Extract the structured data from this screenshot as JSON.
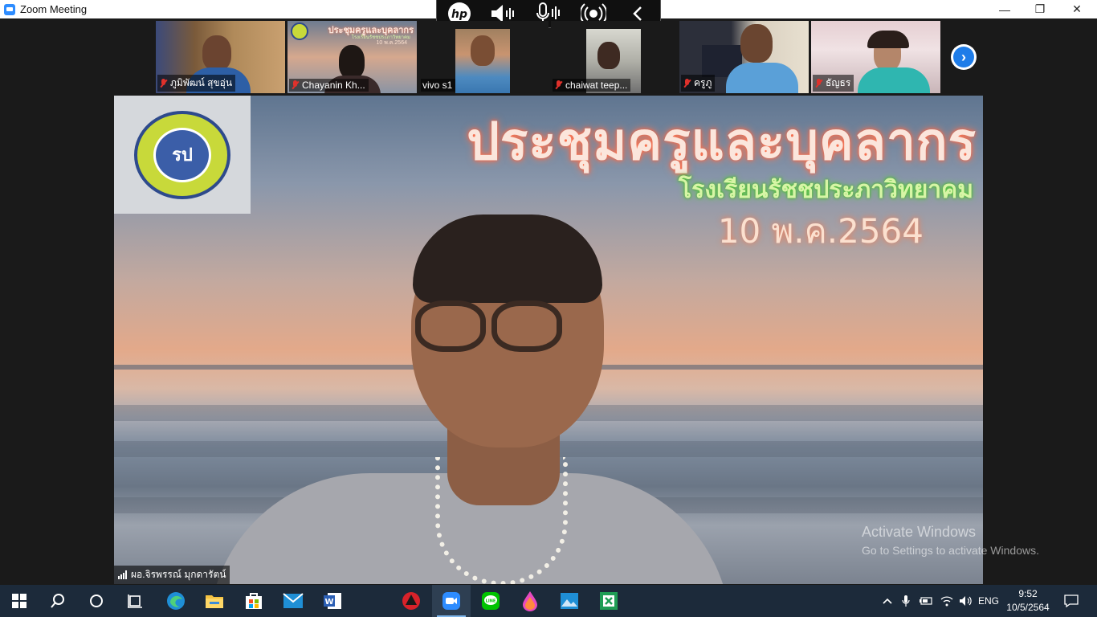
{
  "window": {
    "title": "Zoom Meeting",
    "controls": {
      "minimize": "—",
      "maximize": "❐",
      "close": "✕"
    }
  },
  "hp_toolbar": {
    "logo": "hp",
    "icons": [
      "speaker-icon",
      "microphone-icon",
      "broadcast-icon",
      "chevron-left-icon"
    ]
  },
  "participants": [
    {
      "name": "ภูมิพัฒน์ สุขอุ่น",
      "muted": true
    },
    {
      "name": "Chayanin Kh...",
      "muted": true
    },
    {
      "name": "vivo s1",
      "muted": false
    },
    {
      "name": "chaiwat teep...",
      "muted": true
    },
    {
      "name": "ครูภู",
      "muted": true
    },
    {
      "name": "ธัญธร",
      "muted": true
    }
  ],
  "thumb2_slide": {
    "title": "ประชุมครูและบุคลากร",
    "subtitle": "โรงเรียนรัชชประภาวิทยาคม",
    "date": "10 พ.ค.2564"
  },
  "main_video": {
    "headline": "ประชุมครูและบุคลากร",
    "school": "โรงเรียนรัชชประภาวิทยาคม",
    "date": "10 พ.ค.2564",
    "speaker_name": "ผอ.จิรพรรณ์ มุกดารัตน์"
  },
  "watermark": {
    "line1": "Activate Windows",
    "line2": "Go to Settings to activate Windows."
  },
  "taskbar": {
    "apps": [
      "windows-start-icon",
      "search-icon",
      "cortana-icon",
      "task-view-icon",
      "edge-icon",
      "file-explorer-icon",
      "store-icon",
      "mail-icon",
      "word-icon",
      "app-icon",
      "zoom-icon",
      "line-icon",
      "paint-icon",
      "photos-icon",
      "excel-icon"
    ],
    "language": "ENG",
    "time": "9:52",
    "date": "10/5/2564"
  },
  "colors": {
    "zoom_blue": "#2d8cff",
    "muted_red": "#e0312b",
    "taskbar": "#1c2a3a",
    "headline_glow": "#ff7a55",
    "school_glow": "#5bd63a"
  }
}
